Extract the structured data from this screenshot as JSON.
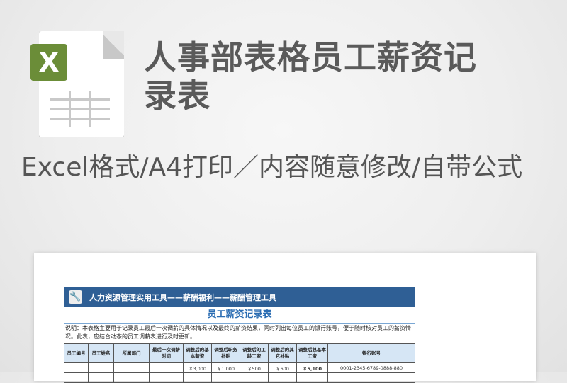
{
  "icon": {
    "badge_letter": "X",
    "badge_color": "#6b8d38"
  },
  "title": "人事部表格员工薪资记录表",
  "subtitle": "Excel格式/A4打印／内容随意修改/自带公式",
  "preview": {
    "banner_text": "人力资源管理实用工具——薪酬福利——薪酬管理工具",
    "sheet_title": "员工薪资记录表",
    "note": "说明：本表格主要用于记录员工最后一次调薪的具体情况以及最终的薪资结果，同时列出每位员工的银行账号，便于随时核对员工的薪资情况。此表，应结合动态的员工调薪表进行及时更新。",
    "headers": [
      "员工编号",
      "员工姓名",
      "所属部门",
      "最后一次调薪时间",
      "调整后的基本薪资",
      "调整后职务补贴",
      "调整后的工龄工资",
      "调整后的其它补贴",
      "调整后总基本工资",
      "银行账号"
    ],
    "row": [
      "",
      "",
      "",
      "",
      "￥3,000",
      "￥1,000",
      "￥500",
      "￥600",
      "￥5,100",
      "0001-2345-6789-0888-880"
    ]
  }
}
